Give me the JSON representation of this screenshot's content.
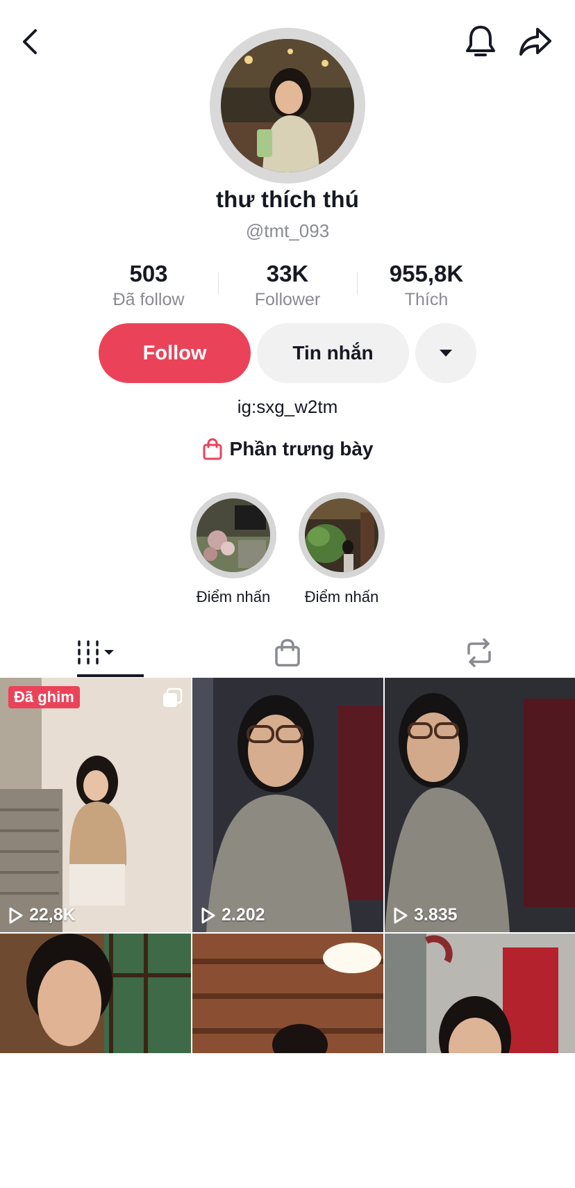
{
  "header": {
    "back_icon": "chevron-left-icon",
    "bell_icon": "bell-icon",
    "share_icon": "share-arrow-icon"
  },
  "profile": {
    "display_name": "thư thích thú",
    "username": "@tmt_093",
    "bio": "ig:sxg_w2tm"
  },
  "stats": [
    {
      "value": "503",
      "label": "Đã follow"
    },
    {
      "value": "33K",
      "label": "Follower"
    },
    {
      "value": "955,8K",
      "label": "Thích"
    }
  ],
  "actions": {
    "follow_label": "Follow",
    "message_label": "Tin nhắn",
    "more_icon": "caret-down-icon"
  },
  "showcase": {
    "label": "Phần trưng bày",
    "icon": "shopping-bag-icon",
    "icon_color": "#ea4359"
  },
  "highlights": [
    {
      "label": "Điểm nhấn"
    },
    {
      "label": "Điểm nhấn"
    }
  ],
  "tabs": [
    {
      "icon": "grid-filter-icon",
      "active": true
    },
    {
      "icon": "shopping-bag-icon",
      "active": false
    },
    {
      "icon": "repost-icon",
      "active": false
    }
  ],
  "videos": [
    {
      "views": "22,8K",
      "pinned_label": "Đã ghim",
      "multi": true
    },
    {
      "views": "2.202"
    },
    {
      "views": "3.835"
    },
    {
      "views": ""
    },
    {
      "views": ""
    },
    {
      "views": ""
    }
  ],
  "colors": {
    "accent": "#ea4359",
    "secondary_button": "#f1f1f2",
    "muted_text": "#8a8b91",
    "text": "#161823"
  }
}
